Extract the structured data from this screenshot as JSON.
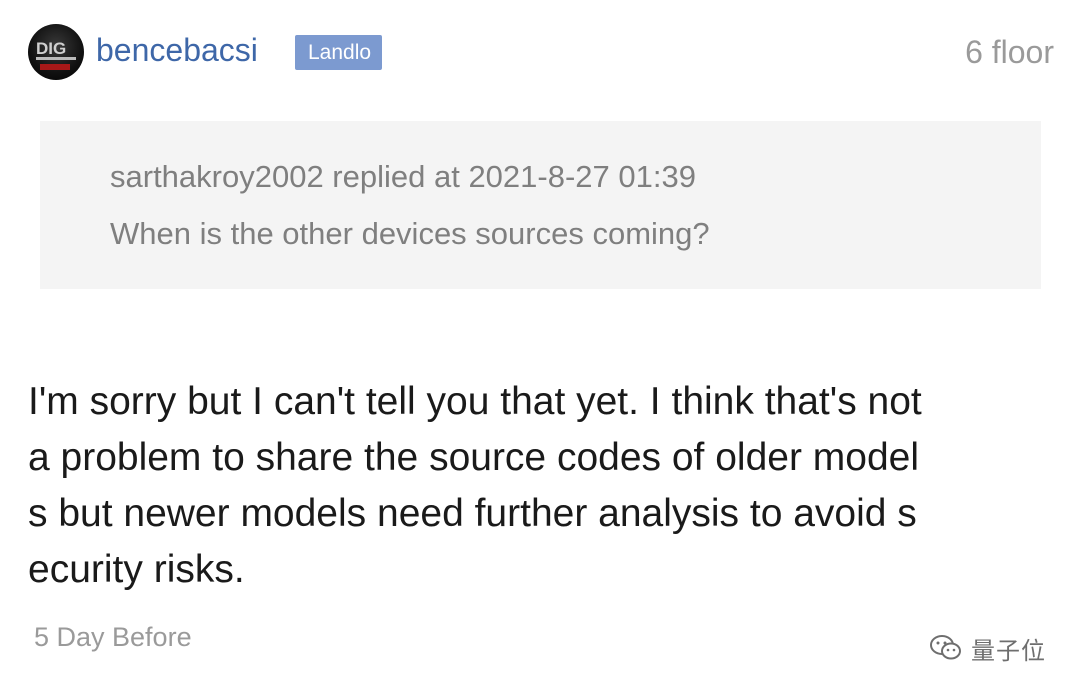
{
  "post": {
    "author": {
      "username": "bencebacsi",
      "badge": "Landlo",
      "avatar_icon": "avatar-logo-icon"
    },
    "floor_label": "6 floor",
    "quote": {
      "meta": "sarthakroy2002 replied at 2021-8-27 01:39",
      "text": "When is the other devices sources coming?"
    },
    "body_lines": [
      "I'm sorry but I can't tell you that yet. I think that's not",
      "a problem to share the source codes of older model",
      "s but newer models need further analysis to avoid s",
      "ecurity risks."
    ],
    "timestamp": "5 Day Before"
  },
  "watermark": {
    "text": "量子位",
    "icon": "wechat-icon"
  },
  "colors": {
    "username": "#3e67a8",
    "badge_bg": "#7c9ad0",
    "quote_bg": "#f4f4f4",
    "muted_text": "#9a9a9a",
    "body_text": "#1a1a1a"
  }
}
